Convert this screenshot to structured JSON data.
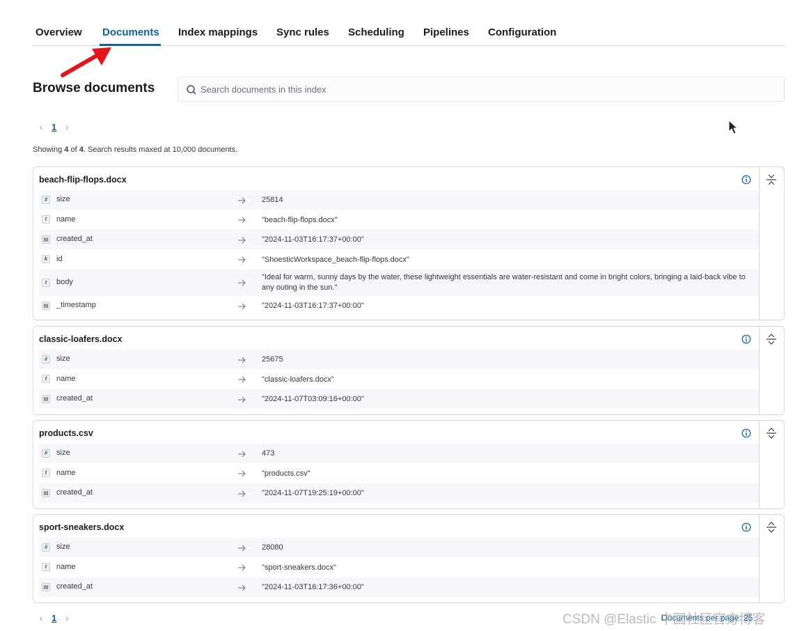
{
  "tabs": [
    {
      "label": "Overview"
    },
    {
      "label": "Documents"
    },
    {
      "label": "Index mappings"
    },
    {
      "label": "Sync rules"
    },
    {
      "label": "Scheduling"
    },
    {
      "label": "Pipelines"
    },
    {
      "label": "Configuration"
    }
  ],
  "active_tab": "Documents",
  "page_title": "Browse documents",
  "search": {
    "placeholder": "Search documents in this index",
    "value": ""
  },
  "pagination": {
    "current_page": "1"
  },
  "showing": {
    "prefix": "Showing",
    "count": "4",
    "of": "of",
    "total": "4",
    "suffix": ". Search results maxed at 10,000 documents."
  },
  "documents": [
    {
      "title": "beach-flip-flops.docx",
      "fields": [
        {
          "type": "#",
          "name": "size",
          "value": "25814"
        },
        {
          "type": "t",
          "name": "name",
          "value": "\"beach-flip-flops.docx\""
        },
        {
          "type": "date",
          "name": "created_at",
          "value": "\"2024-11-03T16:17:37+00:00\""
        },
        {
          "type": "k",
          "name": "id",
          "value": "\"ShoesticWorkspace_beach-flip-flops.docx\""
        },
        {
          "type": "t",
          "name": "body",
          "value": "\"Ideal for warm, sunny days by the water, these lightweight essentials are water-resistant and come in bright colors, bringing a laid-back vibe to any outing in the sun.\""
        },
        {
          "type": "date",
          "name": "_timestamp",
          "value": "\"2024-11-03T16:17:37+00:00\""
        }
      ]
    },
    {
      "title": "classic-loafers.docx",
      "fields": [
        {
          "type": "#",
          "name": "size",
          "value": "25675"
        },
        {
          "type": "t",
          "name": "name",
          "value": "\"classic-loafers.docx\""
        },
        {
          "type": "date",
          "name": "created_at",
          "value": "\"2024-11-07T03:09:16+00:00\""
        }
      ]
    },
    {
      "title": "products.csv",
      "fields": [
        {
          "type": "#",
          "name": "size",
          "value": "473"
        },
        {
          "type": "t",
          "name": "name",
          "value": "\"products.csv\""
        },
        {
          "type": "date",
          "name": "created_at",
          "value": "\"2024-11-07T19:25:19+00:00\""
        }
      ]
    },
    {
      "title": "sport-sneakers.docx",
      "fields": [
        {
          "type": "#",
          "name": "size",
          "value": "28080"
        },
        {
          "type": "t",
          "name": "name",
          "value": "\"sport-sneakers.docx\""
        },
        {
          "type": "date",
          "name": "created_at",
          "value": "\"2024-11-03T16:17:36+00:00\""
        }
      ]
    }
  ],
  "per_page": {
    "label": "Documents per page: 25"
  },
  "watermark": "CSDN @Elastic 中国社区官方博客",
  "colors": {
    "accent": "#0b64a0",
    "annotation_arrow": "#e3141a",
    "border": "#d3dae6",
    "stripe": "#f5f7fa"
  },
  "icons": {
    "search": "search-icon",
    "info": "info-icon",
    "collapse": "collapse-icon",
    "arrow": "arrow-right-icon",
    "chevron_left": "chevron-left-icon",
    "chevron_right": "chevron-right-icon",
    "cursor": "mouse-cursor-icon"
  }
}
